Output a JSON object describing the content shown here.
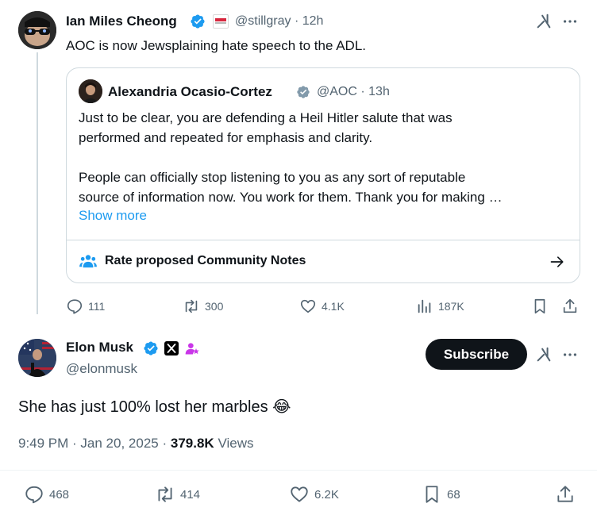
{
  "parent_tweet": {
    "author_name": "Ian Miles Cheong",
    "handle": "@stillgray",
    "time": "12h",
    "affiliate_badge_text": "ROAD TO",
    "text": "AOC is now Jewsplaining hate speech to the ADL.",
    "quote": {
      "author_name": "Alexandria Ocasio-Cortez",
      "handle": "@AOC",
      "time": "13h",
      "lines": [
        "Just to be clear, you are defending a Heil Hitler salute that was",
        "performed and repeated for emphasis and clarity.",
        "People can officially stop listening to you as any sort of reputable",
        "source of information now. You work for them. Thank you for making …"
      ],
      "show_more": "Show more",
      "community_notes_label": "Rate proposed Community Notes"
    },
    "actions": {
      "replies": "111",
      "reposts": "300",
      "likes": "4.1K",
      "views": "187K"
    }
  },
  "main_tweet": {
    "author_name": "Elon Musk",
    "handle": "@elonmusk",
    "subscribe_label": "Subscribe",
    "text": "She has just 100% lost her marbles 😂",
    "timestamp": "9:49 PM · Jan 20, 2025",
    "views_count": "379.8K",
    "views_label": "Views",
    "actions": {
      "replies": "468",
      "reposts": "414",
      "likes": "6.2K",
      "bookmarks": "68"
    }
  },
  "separator": "·",
  "colors": {
    "accent": "#1d9bf0",
    "text": "#0f1419",
    "muted": "#536471",
    "border": "#cfd9de",
    "subscriber_badge": "#c936e8"
  }
}
